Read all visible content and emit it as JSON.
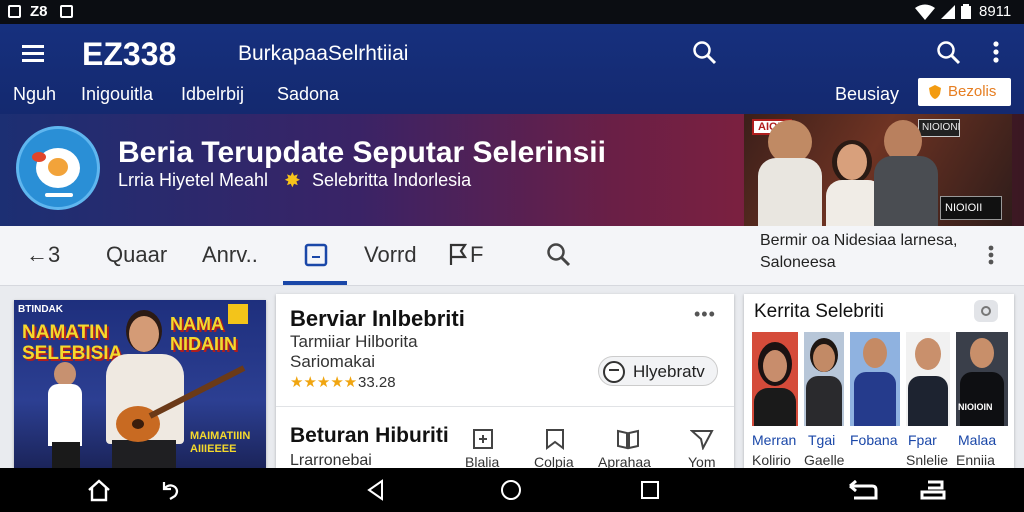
{
  "status_bar": {
    "left_text": "Z8",
    "right_text": "8911"
  },
  "app_bar": {
    "logo": "EZ338",
    "title": "BurkapaaSelrhtiiai",
    "tabs": [
      "Nguh",
      "Inigouitla",
      "Idbelrbij",
      "Sadona"
    ],
    "right_link": "Beusiay",
    "action_button": "Bezolis"
  },
  "hero": {
    "title": "Beria Terupdate Seputar Selerinsii",
    "subtitle": "Lrria Hiyetel Meahl",
    "subtitle_2": "Selebritta Indorlesia",
    "photo_label_left": "AIOIO",
    "photo_label_right": "NIOIONI",
    "photo_caption": "NIOIOII"
  },
  "toolbar": {
    "items": [
      "←3",
      "Quaar",
      "Anrv..",
      "Vorrd",
      "F"
    ],
    "info_line1": "Bermir oa Nidesiaa larnesa,",
    "info_line2": "Saloneesa"
  },
  "left_card": {
    "poster_top_tag": "BTINDAK",
    "poster_title": "NAMATIN SELEBISIA",
    "poster_title_right": "NAMA NIDAIIN",
    "poster_bottom": "MAIMATIIIN AIIIEEEE"
  },
  "middle_card": {
    "title": "Berviar Inlbebriti",
    "subtitle": "Tarmiiar Hilborita",
    "meta": "Sariomakai",
    "rating": "★★★★★",
    "rating_value": "33.28",
    "chip_label": "Hlyebratv",
    "more": "•••",
    "section2_title": "Beturan Hiburiti",
    "section2_sub": "Lrarronebai",
    "actions": [
      "Blalia",
      "Colpia",
      "Aprahaa",
      "Yom"
    ]
  },
  "right_card": {
    "title": "Kerrita Selebriti",
    "people": [
      {
        "name": "Merran",
        "sub": "Kolirio",
        "color": "#1a47a8"
      },
      {
        "name": "Tgai",
        "sub": "Gaelle",
        "color": "#1a47a8"
      },
      {
        "name": "Fobana",
        "sub": "",
        "color": "#1a47a8"
      },
      {
        "name": "Fpar",
        "sub": "Snlelie",
        "color": "#1a47a8"
      },
      {
        "name": "Malaa",
        "sub": "Enniia",
        "color": "#1a47a8"
      }
    ],
    "last_poster_text": "NIOIOIN"
  },
  "colors": {
    "appbar": "#16307e",
    "accent": "#f39c12",
    "link": "#1a47a8"
  }
}
